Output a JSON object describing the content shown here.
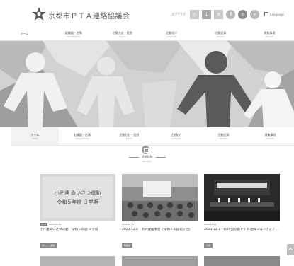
{
  "site": {
    "name": "京都市ＰＴＡ連絡協議会"
  },
  "header": {
    "text": "文字サイズ",
    "lang": "Language",
    "size_small": "小",
    "size_medium": "中",
    "size_large": "大"
  },
  "top_nav": [
    {
      "label": "ホーム",
      "sub": ""
    },
    {
      "label": "組織図・名簿",
      "sub": "ORGANIZATION"
    },
    {
      "label": "活動方針・役割",
      "sub": "POLICY"
    },
    {
      "label": "活動紹介",
      "sub": "ACTIVITIES"
    },
    {
      "label": "活動記録",
      "sub": "RECORD"
    },
    {
      "label": "募集事項",
      "sub": "RECRUIT"
    }
  ],
  "sub_nav": [
    {
      "label": "ホーム",
      "sub": "HOME"
    },
    {
      "label": "組織図・名簿",
      "sub": "ORGANIZATION"
    },
    {
      "label": "活動方針・役割",
      "sub": "POLICY"
    },
    {
      "label": "活動紹介",
      "sub": "ACTIVITIES"
    },
    {
      "label": "活動記録",
      "sub": "RECORD"
    },
    {
      "label": "募集事項",
      "sub": "RECRUIT"
    }
  ],
  "section": {
    "title": "活動記録",
    "sub": "RECORD"
  },
  "cards": [
    {
      "image_text_1": "小Ｐ連 ゐいさつ運動",
      "image_text_2": "令和５年度 ３学期",
      "date": "2024.01.16",
      "tag": "NEW",
      "title": "小Ｐ連あいさつ運動　令和５年度 ３学期",
      "category": "あいさつ運動"
    },
    {
      "date": "2023.12.15",
      "tag": "",
      "title": "2023.12.8　市Ｐ連理事会（令和５年度第５回）",
      "category": "理事会"
    },
    {
      "date": "2023.12.01",
      "tag": "",
      "title": "2023.12.1　第49回京都ＰＴＡ北線フロンティア…",
      "category": "大会"
    }
  ],
  "colors": {
    "hero_bg": "#d4d4d4",
    "card_dark": "#2a2a2a"
  }
}
